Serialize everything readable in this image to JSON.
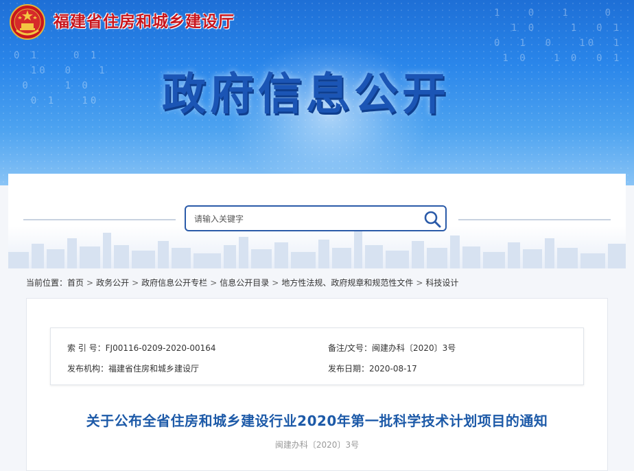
{
  "header": {
    "org_name": "福建省住房和城乡建设厅",
    "site_title": "政府信息公开",
    "binary_left": "0 1    0 1\n  10  0   1\n 0    1 0\n  0 1   10",
    "binary_right": "1   0   1    0\n  1 0    1  0 1\n0  1  0   10  1\n 1 0   1 0  0 1"
  },
  "search": {
    "placeholder": "请输入关键字"
  },
  "breadcrumb": {
    "prefix": "当前位置：",
    "items": [
      "首页",
      "政务公开",
      "政府信息公开专栏",
      "信息公开目录",
      "地方性法规、政府规章和规范性文件",
      "科技设计"
    ],
    "separator": ">"
  },
  "meta": {
    "index_label": "索 引 号：",
    "index_value": "FJ00116-0209-2020-00164",
    "doc_label": "备注/文号：",
    "doc_value": "闽建办科〔2020〕3号",
    "publisher_label": "发布机构：",
    "publisher_value": "福建省住房和城乡建设厅",
    "date_label": "发布日期：",
    "date_value": "2020-08-17"
  },
  "article": {
    "title": "关于公布全省住房和城乡建设行业2020年第一批科学技术计划项目的通知",
    "doc_number": "闽建办科〔2020〕3号"
  },
  "colors": {
    "banner": "#2a86ea",
    "title_blue": "#1d5aa8",
    "org_red": "#c8161d"
  }
}
